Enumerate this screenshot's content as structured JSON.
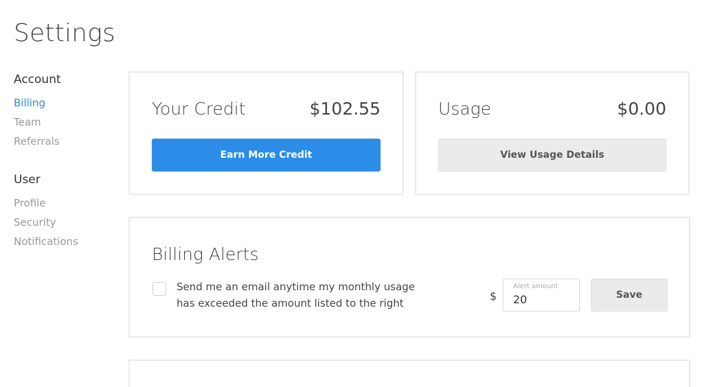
{
  "page": {
    "title": "Settings"
  },
  "sidebar": {
    "sections": [
      {
        "heading": "Account",
        "items": [
          "Billing",
          "Team",
          "Referrals"
        ]
      },
      {
        "heading": "User",
        "items": [
          "Profile",
          "Security",
          "Notifications"
        ]
      }
    ],
    "active_item": "Billing"
  },
  "credit_card": {
    "title": "Your Credit",
    "value": "$102.55",
    "button_label": "Earn More Credit"
  },
  "usage_card": {
    "title": "Usage",
    "value": "$0.00",
    "button_label": "View Usage Details"
  },
  "billing_alerts": {
    "title": "Billing Alerts",
    "checkbox_checked": false,
    "description": "Send me an email anytime my monthly usage has exceeded the amount listed to the right",
    "currency_symbol": "$",
    "amount_label": "Alert amount",
    "amount_value": "20",
    "save_label": "Save"
  },
  "colors": {
    "accent": "#2b8de8",
    "border": "#eaeaea",
    "muted_text": "#999999",
    "button_gray": "#ebebeb"
  }
}
